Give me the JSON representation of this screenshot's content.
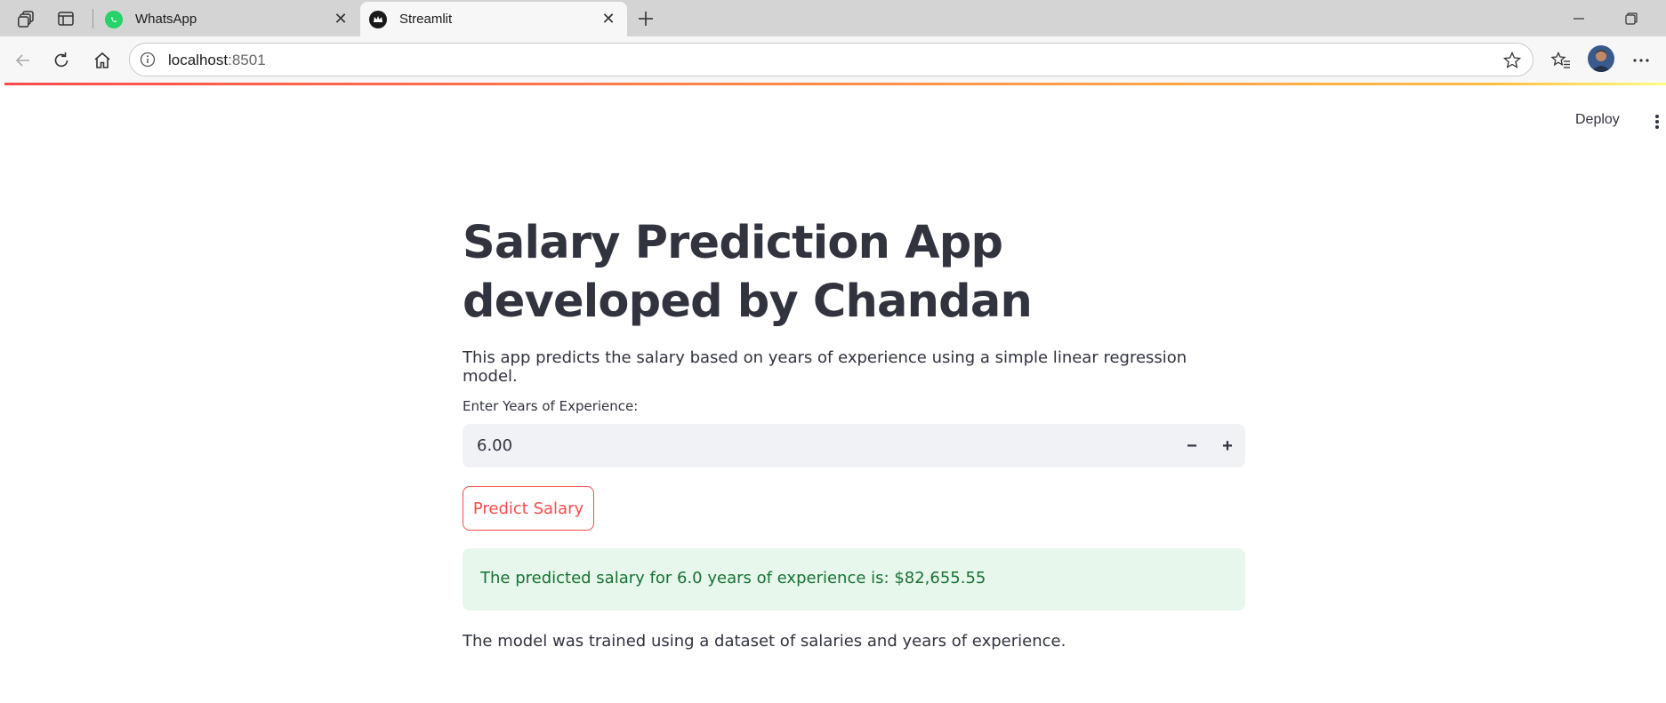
{
  "browser": {
    "tabs": [
      {
        "title": "WhatsApp",
        "active": false
      },
      {
        "title": "Streamlit",
        "active": true
      }
    ],
    "address": {
      "host": "localhost",
      "port": ":8501"
    }
  },
  "app": {
    "deploy_label": "Deploy",
    "title": "Salary Prediction App developed by Chandan",
    "description": "This app predicts the salary based on years of experience using a simple linear regression model.",
    "input": {
      "label": "Enter Years of Experience:",
      "value": "6.00",
      "decrement": "−",
      "increment": "+"
    },
    "predict_button": "Predict Salary",
    "result": "The predicted salary for 6.0 years of experience is: $82,655.55",
    "footer": "The model was trained using a dataset of salaries and years of experience."
  },
  "colors": {
    "accent": "#ff4b4b",
    "success_bg": "#e8f7ec",
    "success_text": "#177233",
    "text": "#31333f",
    "input_bg": "#f0f2f6"
  }
}
